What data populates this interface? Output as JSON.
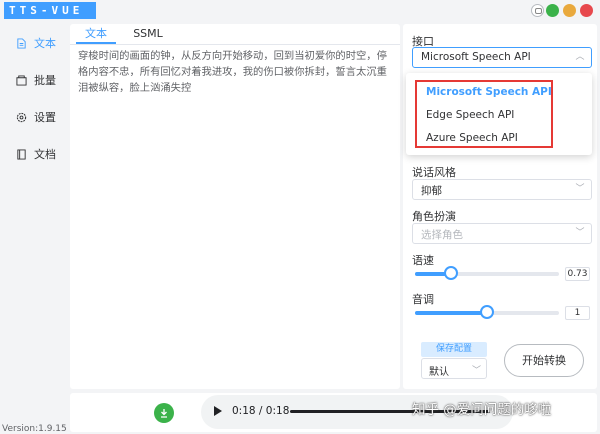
{
  "app": {
    "logo": "TTS-VUE",
    "version_prefix": "Version:1.9.15",
    "version_refresh_icon": "refresh-icon"
  },
  "window_controls": [
    {
      "name": "feedback-icon",
      "color": "#ffffff"
    },
    {
      "name": "minimize",
      "color": "#3bb24a"
    },
    {
      "name": "maximize",
      "color": "#e9a93d"
    },
    {
      "name": "close",
      "color": "#e7484d"
    }
  ],
  "sidebar": {
    "items": [
      {
        "label": "文本",
        "icon": "document-icon",
        "active": true
      },
      {
        "label": "批量",
        "icon": "folder-icon",
        "active": false
      },
      {
        "label": "设置",
        "icon": "gear-icon",
        "active": false
      },
      {
        "label": "文档",
        "icon": "book-icon",
        "active": false
      }
    ]
  },
  "editor": {
    "tabs": [
      {
        "label": "文本",
        "active": true
      },
      {
        "label": "SSML",
        "active": false
      }
    ],
    "text": "穿梭时间的画面的钟，从反方向开始移动，回到当初爱你的时空，停格内容不忠，所有回忆对着我进攻，我的伤口被你拆封，誓言太沉重泪被纵容，脸上汹涌失控"
  },
  "settings": {
    "api": {
      "label": "接口",
      "value": "Microsoft Speech API",
      "options": [
        "Microsoft Speech API",
        "Edge Speech API",
        "Azure Speech API"
      ],
      "selected_index": 0
    },
    "style": {
      "label": "说话风格",
      "value": "抑郁"
    },
    "role": {
      "label": "角色扮演",
      "placeholder": "选择角色"
    },
    "rate": {
      "label": "语速",
      "value": "0.73",
      "fraction": 0.25
    },
    "pitch": {
      "label": "音调",
      "value": "1",
      "fraction": 0.5
    },
    "save_config_label": "保存配置",
    "config_select_value": "默认",
    "start_button_label": "开始转换"
  },
  "player": {
    "time": "0:18 / 0:18",
    "progress": 1.0,
    "download_icon": "download-icon"
  },
  "watermark": "知乎 @爱问问题的哆啦",
  "colors": {
    "accent": "#409eff",
    "highlight_box": "#e53935",
    "download": "#3bb24a"
  }
}
